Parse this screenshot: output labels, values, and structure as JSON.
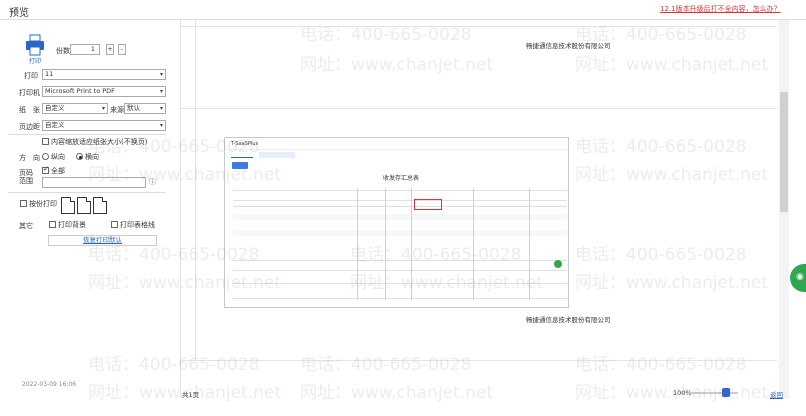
{
  "window": {
    "title": "预览",
    "upgrade_link": "12.1版本升级后打不全内容，怎么办？"
  },
  "left_panel": {
    "print_button_label": "打印",
    "copies_label": "份数",
    "copies_value": "1",
    "copies_plus": "+",
    "copies_minus": "-",
    "print_range_label": "打印",
    "print_range_value": "11",
    "printer_label": "打印机",
    "printer_value": "Microsoft Print to PDF",
    "paper_label": "纸　张",
    "paper_value": "自定义",
    "source_label": "来源",
    "source_value": "默认",
    "margin_label": "页边距",
    "margin_value": "自定义",
    "fit_width_label": "内容缩放适应纸张大小(不换页)",
    "orientation_label": "方　向",
    "portrait_label": "纵向",
    "landscape_label": "横向",
    "page_range_label": "页码范围",
    "all_pages_label": "全部",
    "collate_label": "按份打印",
    "other_label": "其它",
    "print_grid_label": "打印背景",
    "print_empty_label": "打印表格线",
    "restore_button_label": "恢复打印默认"
  },
  "preview": {
    "company_header": "畅捷通信息技术股份有限公司",
    "company_footer": "畅捷通信息技术股份有限公司",
    "sheet": {
      "brand": "T-SaaSPlus",
      "title": "收发存汇总表"
    }
  },
  "status": {
    "left_text": "2022-03-09 16:06",
    "page_indicator": "共1页",
    "zoom_label": "100%",
    "back_link": "返回"
  },
  "watermark": {
    "phone": "电话：400-665-0028",
    "site": "网址：www.chanjet.net"
  }
}
